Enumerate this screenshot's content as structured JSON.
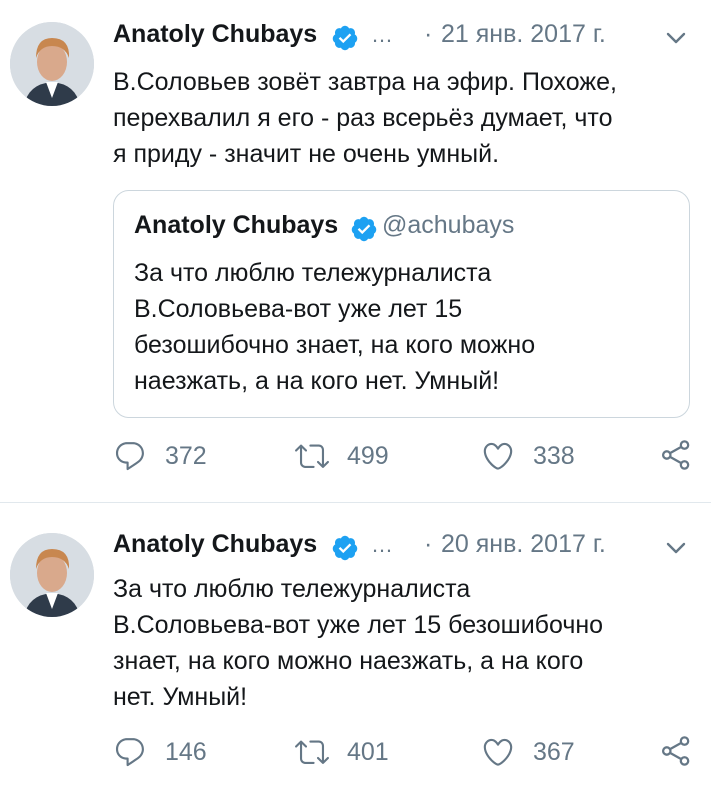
{
  "tweets": [
    {
      "author": {
        "name": "Anatoly Chubays",
        "verified": true
      },
      "more": "…",
      "separator": "·",
      "date": "21 янв. 2017 г.",
      "text": "В.Соловьев зовёт завтра на эфир. Похоже,\nперехвалил я его - раз всерьёз думает, что\nя приду - значит не очень умный.",
      "quote": {
        "name": "Anatoly Chubays",
        "handle": "@achubays",
        "text": "За что люблю тележурналиста\nВ.Соловьева-вот уже лет 15\nбезошибочно знает, на кого можно\nнаезжать, а на кого нет. Умный!"
      },
      "stats": {
        "replies": "372",
        "retweets": "499",
        "likes": "338"
      }
    },
    {
      "author": {
        "name": "Anatoly Chubays",
        "verified": true
      },
      "more": "…",
      "separator": "·",
      "date": "20 янв. 2017 г.",
      "text": "За что люблю тележурналиста\nВ.Соловьева-вот уже лет 15 безошибочно\nзнает, на кого можно наезжать, а на кого\nнет. Умный!",
      "stats": {
        "replies": "146",
        "retweets": "401",
        "likes": "367"
      }
    }
  ],
  "colors": {
    "accent": "#1da1f2",
    "muted": "#657786",
    "text": "#14171a",
    "border": "#ccd6dd"
  },
  "icons": [
    "verified-icon",
    "chevron-down-icon",
    "reply-icon",
    "retweet-icon",
    "like-icon",
    "share-icon"
  ]
}
